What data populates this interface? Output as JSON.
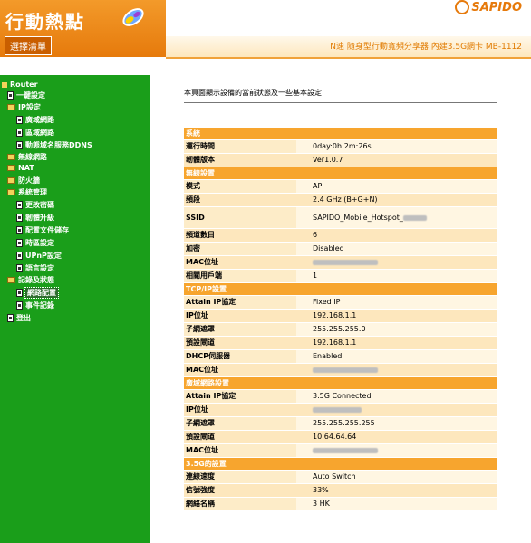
{
  "header": {
    "app_title": "行動熱點",
    "menu_tab": "選擇清單",
    "brand": "SAPIDO",
    "product_text": "N速 隨身型行動寬頻分享器 內建3.5G網卡 MB-1112"
  },
  "sidebar": {
    "root": "Router",
    "items": [
      {
        "label": "一鍵設定"
      },
      {
        "label": "IP設定"
      },
      {
        "label": "廣域網路"
      },
      {
        "label": "區域網路"
      },
      {
        "label": "動態域名服務DDNS"
      },
      {
        "label": "無線網路"
      },
      {
        "label": "NAT"
      },
      {
        "label": "防火牆"
      },
      {
        "label": "系統管理"
      },
      {
        "label": "更改密碼"
      },
      {
        "label": "韌體升級"
      },
      {
        "label": "配置文件儲存"
      },
      {
        "label": "時區設定"
      },
      {
        "label": "UPnP設定"
      },
      {
        "label": "語言設定"
      },
      {
        "label": "記錄及狀態"
      },
      {
        "label": "網路配置"
      },
      {
        "label": "事件記錄"
      },
      {
        "label": "登出"
      }
    ]
  },
  "main": {
    "description": "本頁面顯示設備的當前狀態及一些基本設定",
    "sections": [
      {
        "title": "系統",
        "rows": [
          {
            "label": "運行時間",
            "value": "0day:0h:2m:26s"
          },
          {
            "label": "韌體版本",
            "value": "Ver1.0.7"
          }
        ]
      },
      {
        "title": "無線設置",
        "rows": [
          {
            "label": "模式",
            "value": "AP"
          },
          {
            "label": "頻段",
            "value": "2.4 GHz (B+G+N)"
          },
          {
            "label": "SSID",
            "value": "SAPIDO_Mobile_Hotspot_"
          },
          {
            "label": "頻道數目",
            "value": "6"
          },
          {
            "label": "加密",
            "value": "Disabled"
          },
          {
            "label": "MAC位址",
            "value": ""
          },
          {
            "label": "相關用戶端",
            "value": "1"
          }
        ]
      },
      {
        "title": "TCP/IP設置",
        "rows": [
          {
            "label": "Attain IP協定",
            "value": "Fixed IP"
          },
          {
            "label": "IP位址",
            "value": "192.168.1.1"
          },
          {
            "label": "子網遮罩",
            "value": "255.255.255.0"
          },
          {
            "label": "預設閘道",
            "value": "192.168.1.1"
          },
          {
            "label": "DHCP伺服器",
            "value": "Enabled"
          },
          {
            "label": "MAC位址",
            "value": ""
          }
        ]
      },
      {
        "title": "廣域網路設置",
        "rows": [
          {
            "label": "Attain IP協定",
            "value": "3.5G Connected"
          },
          {
            "label": "IP位址",
            "value": ""
          },
          {
            "label": "子網遮罩",
            "value": "255.255.255.255"
          },
          {
            "label": "預設閘道",
            "value": "10.64.64.64"
          },
          {
            "label": "MAC位址",
            "value": ""
          }
        ]
      },
      {
        "title": "3.5G的設置",
        "rows": [
          {
            "label": "連線速度",
            "value": "Auto Switch"
          },
          {
            "label": "信號強度",
            "value": "33%"
          },
          {
            "label": "網絡名稱",
            "value": "3 HK"
          }
        ]
      }
    ]
  }
}
